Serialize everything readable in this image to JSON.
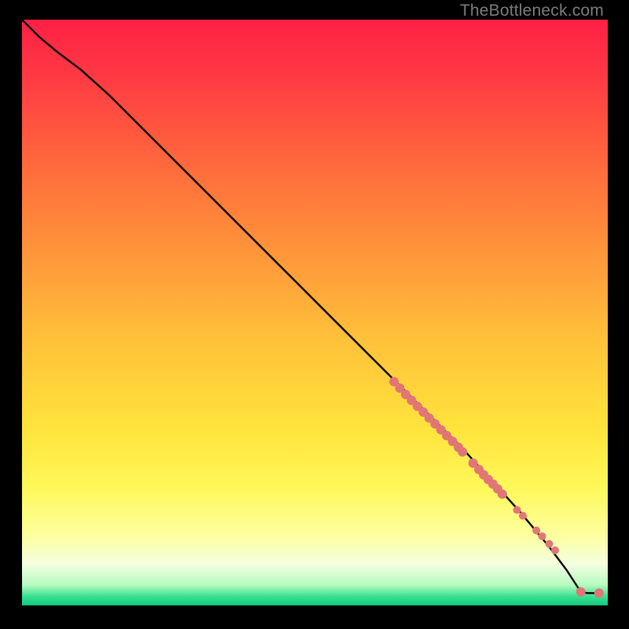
{
  "watermark": "TheBottleneck.com",
  "colors": {
    "background": "#000000",
    "curve": "#000000",
    "marker": "#e27676",
    "gradient_stops": [
      {
        "offset": 0.0,
        "color": "#ff2045"
      },
      {
        "offset": 0.1,
        "color": "#ff3a43"
      },
      {
        "offset": 0.25,
        "color": "#ff6a3c"
      },
      {
        "offset": 0.4,
        "color": "#ff963a"
      },
      {
        "offset": 0.55,
        "color": "#ffc23a"
      },
      {
        "offset": 0.7,
        "color": "#ffe43c"
      },
      {
        "offset": 0.8,
        "color": "#fff85a"
      },
      {
        "offset": 0.88,
        "color": "#fdff9e"
      },
      {
        "offset": 0.93,
        "color": "#f4ffe0"
      },
      {
        "offset": 0.965,
        "color": "#b6fbc0"
      },
      {
        "offset": 0.985,
        "color": "#38e08f"
      },
      {
        "offset": 1.0,
        "color": "#11c97e"
      }
    ]
  },
  "chart_data": {
    "type": "line",
    "title": "",
    "xlabel": "",
    "ylabel": "",
    "xlim": [
      0,
      100
    ],
    "ylim": [
      0,
      100
    ],
    "grid": false,
    "series": [
      {
        "name": "curve",
        "x": [
          0,
          3,
          6,
          10,
          15,
          20,
          25,
          30,
          35,
          40,
          45,
          50,
          55,
          60,
          65,
          70,
          75,
          80,
          85,
          90,
          93,
          95.4,
          96.5,
          98.5
        ],
        "y": [
          100,
          97,
          94.5,
          91.5,
          87,
          82,
          77,
          72,
          67,
          62,
          57,
          52,
          47,
          42,
          37,
          32,
          27,
          21.5,
          16,
          10,
          6,
          2.3,
          2.1,
          2.1
        ]
      }
    ],
    "markers": {
      "name": "data-points",
      "x": [
        63.5,
        64.5,
        65.5,
        66.5,
        67.5,
        68.5,
        69.5,
        70.5,
        71.5,
        72.5,
        73.5,
        74.5,
        75.2,
        77.0,
        78.0,
        78.8,
        79.6,
        80.4,
        81.2,
        82.0,
        84.5,
        85.5,
        87.8,
        88.8,
        90.0,
        91.0,
        95.4,
        98.5
      ],
      "y": [
        38.2,
        37.1,
        36.0,
        35.0,
        34.0,
        33.0,
        32.0,
        31.0,
        30.0,
        29.0,
        28.0,
        27.0,
        26.2,
        24.3,
        23.2,
        22.3,
        21.5,
        20.7,
        19.9,
        19.0,
        16.3,
        15.3,
        12.8,
        11.8,
        10.5,
        9.4,
        2.3,
        2.1
      ],
      "r": [
        6,
        6,
        6,
        6,
        6,
        6,
        6,
        6,
        6,
        6,
        6,
        6,
        6,
        6,
        6,
        6,
        6,
        6,
        6,
        6,
        5,
        5,
        5,
        5,
        5,
        5,
        6,
        6
      ]
    }
  }
}
